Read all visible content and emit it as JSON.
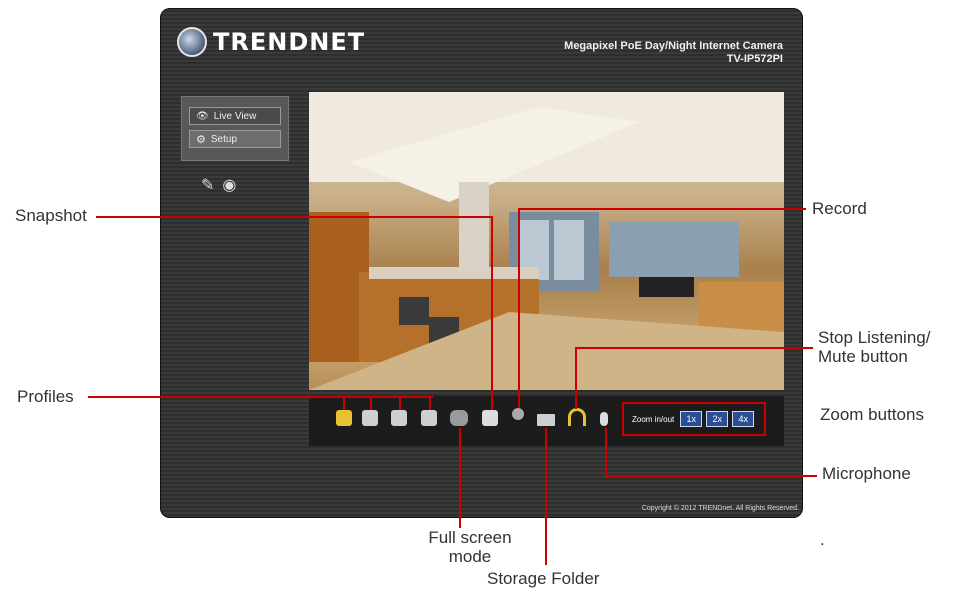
{
  "app": {
    "brand": "TRENDNET",
    "product_line1": "Megapixel PoE Day/Night Internet Camera",
    "product_line2": "TV-IP572PI",
    "copyright": "Copyright © 2012 TRENDnet. All Rights Reserved."
  },
  "nav": {
    "live_view": "Live View",
    "setup": "Setup"
  },
  "zoom": {
    "label": "Zoom in/out",
    "buttons": [
      "1x",
      "2x",
      "4x"
    ]
  },
  "annotations": {
    "snapshot": "Snapshot",
    "record": "Record",
    "profiles": "Profiles",
    "stop_listening_l1": "Stop Listening/",
    "stop_listening_l2": "Mute button",
    "zoom_buttons": "Zoom buttons",
    "microphone": "Microphone",
    "full_screen_l1": "Full screen",
    "full_screen_l2": "mode",
    "storage_folder": "Storage Folder",
    "dot": "."
  },
  "colors": {
    "callout_line": "#cc0000",
    "zoom_button": "#2b4f96"
  }
}
